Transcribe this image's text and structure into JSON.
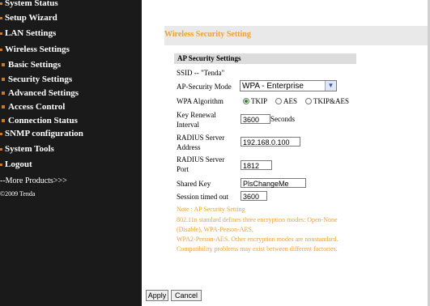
{
  "sidebar": {
    "items": [
      {
        "label": "System Status"
      },
      {
        "label": "Setup Wizard"
      },
      {
        "label": "LAN Settings"
      },
      {
        "label": "Wireless Settings"
      },
      {
        "label": "Basic Settings"
      },
      {
        "label": "Security Settings"
      },
      {
        "label": "Advanced Settings"
      },
      {
        "label": "Access Control"
      },
      {
        "label": "Connection Status"
      },
      {
        "label": "SNMP configuration"
      },
      {
        "label": "System Tools"
      },
      {
        "label": "Logout"
      }
    ],
    "more_products": "--More Products>>>",
    "copyright": "©2009 Tenda"
  },
  "page": {
    "title": "Wireless Security Setting",
    "section_header": "AP Security Settings",
    "ssid_text": "SSID -- \"Tenda\"",
    "mode_label": "AP-Security Mode",
    "mode_value": "WPA - Enterprise",
    "algorithm_label": "WPA Algorithm",
    "algorithm_options": [
      "TKIP",
      "AES",
      "TKIP&AES"
    ],
    "algorithm_selected": "TKIP",
    "renewal_label_1": "Key Renewal",
    "renewal_label_2": "Interval",
    "renewal_value": "3600",
    "renewal_unit": "Seconds",
    "radius_addr_label_1": "RADIUS Server",
    "radius_addr_label_2": "Address",
    "radius_addr_value": "192.168.0.100",
    "radius_port_label_1": "RADIUS Server",
    "radius_port_label_2": "Port",
    "radius_port_value": "1812",
    "shared_key_label": "Shared Key",
    "shared_key_value": "PlsChangeMe",
    "session_label": "Session timed out",
    "session_value": "3600",
    "note_title": "Note : AP Security Setting",
    "note_lines": [
      "802.11n standard defines three encryption modes: Open-None",
      "(Disable), WPA-Person-AES,",
      "WPA2-Person-AES. Other encryption modes are nonstandard.",
      "Compatibility problems may exist between different factories."
    ],
    "apply_label": "Apply",
    "cancel_label": "Cancel"
  },
  "colors": {
    "sidebar_bg": "#1a1a1a",
    "accent_orange": "#e8a23a",
    "section_bg": "#dcdcdc"
  }
}
